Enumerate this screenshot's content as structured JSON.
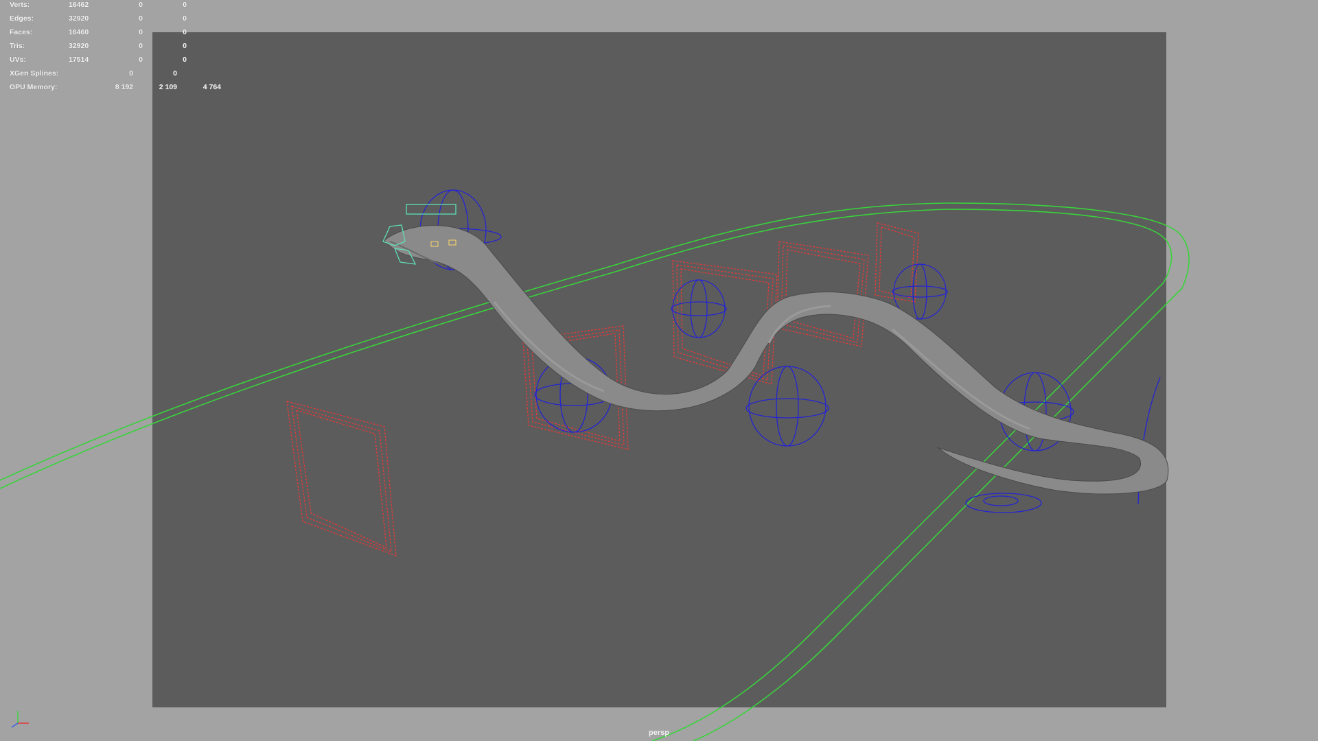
{
  "hud": {
    "rows": [
      {
        "label": "Verts:",
        "v1": "16462",
        "v2": "0",
        "v3": "0"
      },
      {
        "label": "Edges:",
        "v1": "32920",
        "v2": "0",
        "v3": "0"
      },
      {
        "label": "Faces:",
        "v1": "16460",
        "v2": "0",
        "v3": "0"
      },
      {
        "label": "Tris:",
        "v1": "32920",
        "v2": "0",
        "v3": "0"
      },
      {
        "label": "UVs:",
        "v1": "17514",
        "v2": "0",
        "v3": "0"
      },
      {
        "label": "XGen Splines:",
        "v1": "0",
        "v2": "0"
      },
      {
        "label": "GPU Memory:",
        "v1": "8 192",
        "v2": "2 109",
        "v3": "4 764"
      }
    ]
  },
  "camera": {
    "name": "persp"
  },
  "icons": {
    "axis": "xyz-axis-icon"
  },
  "colors": {
    "background": "#a3a3a3",
    "gate": "#5c5c5c",
    "curve_green": "#39d33b",
    "control_red": "#e63a3a",
    "control_blue": "#2424d4",
    "head_cyan": "#5de0b8",
    "snake": "#8a8a8a"
  }
}
